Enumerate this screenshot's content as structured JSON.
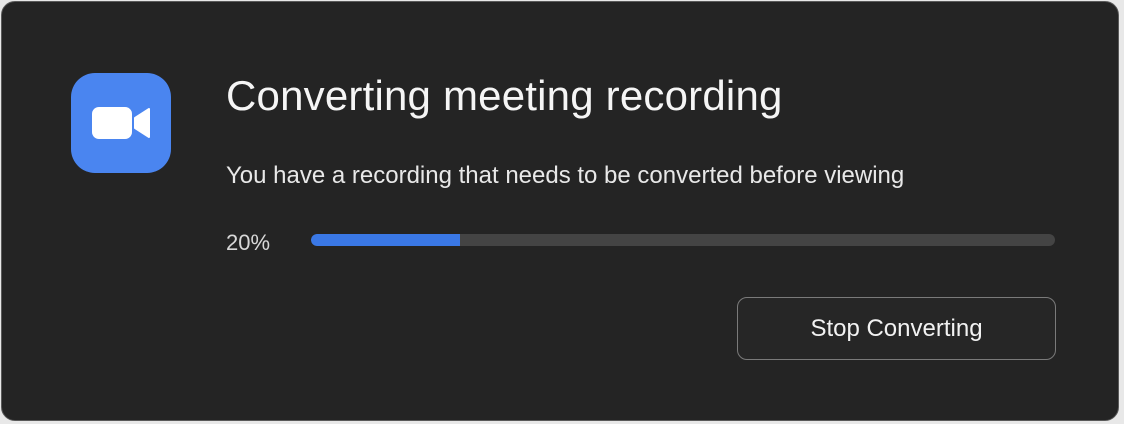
{
  "dialog": {
    "title": "Converting meeting recording",
    "message": "You have a recording that needs to be converted before viewing",
    "progress": {
      "label": "20%",
      "fraction": 0.2
    },
    "stop_button_label": "Stop Converting"
  },
  "icons": {
    "app": "video-camera-icon"
  },
  "colors": {
    "app_icon_bg": "#4a85f0",
    "progress_fill": "#3a78e6",
    "dialog_bg": "#242424"
  }
}
